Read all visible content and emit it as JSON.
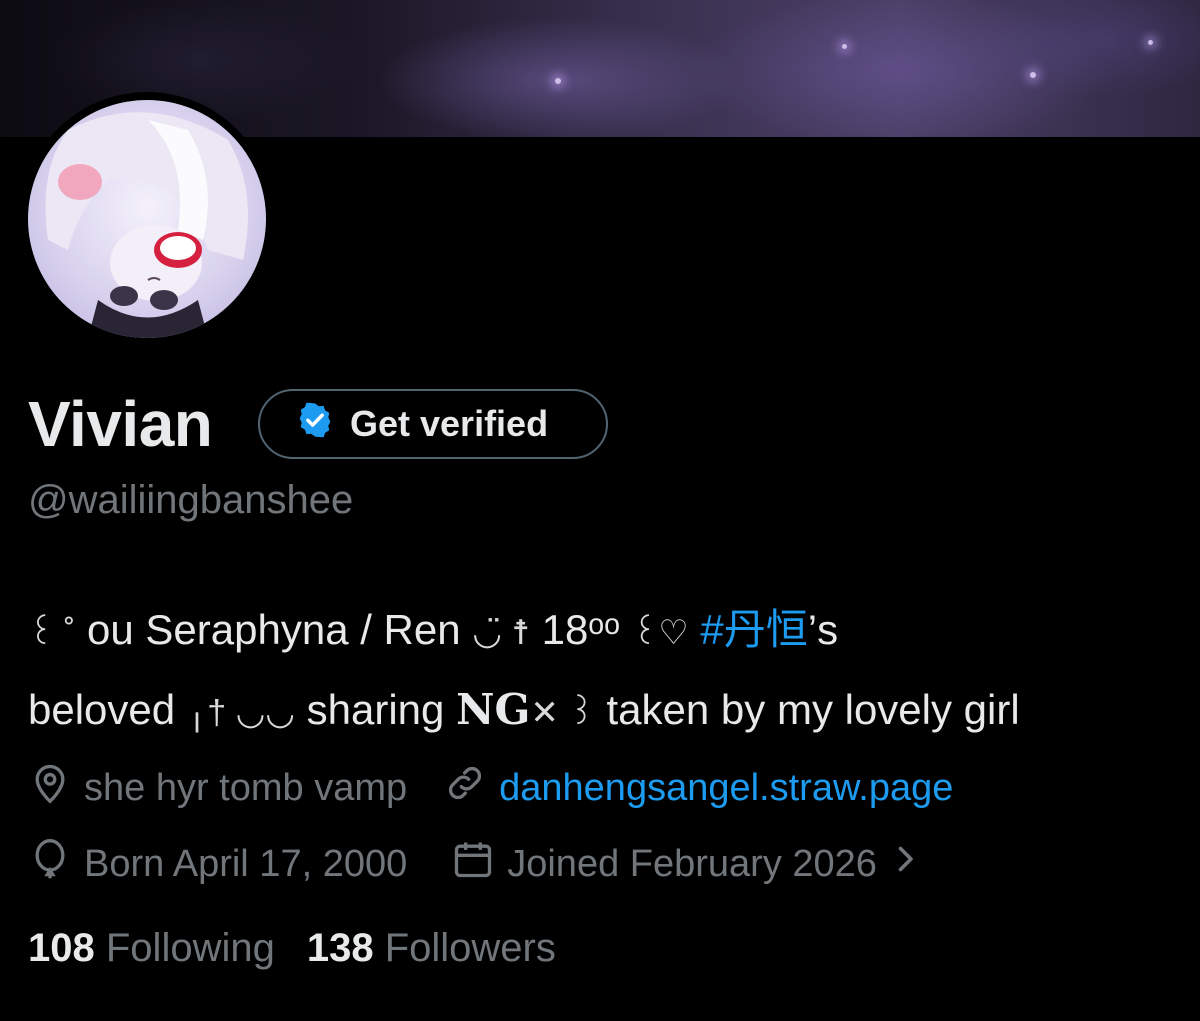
{
  "profile": {
    "display_name": "Vivian",
    "verify_button_label": "Get verified",
    "handle": "@wailiingbanshee"
  },
  "bio": {
    "line1": {
      "deco_start": "꒰ ˚",
      "text_a": "ou Seraphyna / Ren",
      "deco_mid": "◡̈ ☨",
      "text_b": "18ᵒᵒ",
      "deco_heart": "꒰♡",
      "hashtag": "#丹恒",
      "text_c": "’s"
    },
    "line2": {
      "text_a": "beloved",
      "deco_a": "╷† ◡◡",
      "text_b": "sharing",
      "ng": "NG",
      "deco_b": "✕ ꒱",
      "text_c": "taken by my lovely girl"
    }
  },
  "meta": {
    "location": "she  hyr  tomb  vamp",
    "website": "danhengsangel.straw.page",
    "birthday": "Born April 17, 2000",
    "joined": "Joined February 2026"
  },
  "stats": {
    "following_count": "108",
    "following_label": "Following",
    "followers_count": "138",
    "followers_label": "Followers"
  },
  "colors": {
    "accent": "#1d9bf0",
    "secondary_text": "#71767b",
    "primary_text": "#e7e9ea",
    "background": "#000000"
  },
  "icons": [
    "location-icon",
    "link-icon",
    "birthday-balloon-icon",
    "calendar-icon",
    "chevron-right-icon",
    "verified-badge-icon"
  ]
}
